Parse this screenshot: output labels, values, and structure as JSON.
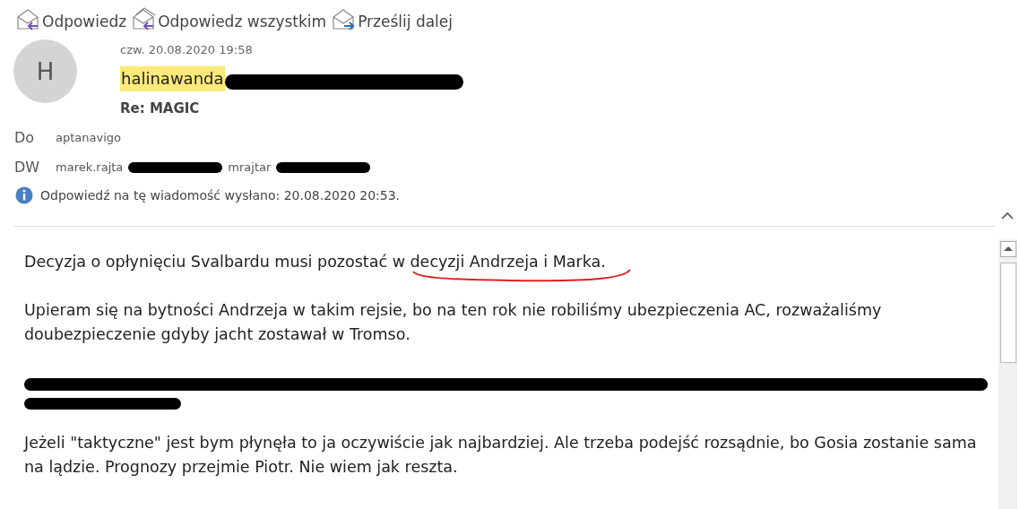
{
  "toolbar": [
    {
      "label": "Odpowiedz",
      "kind": "reply"
    },
    {
      "label": "Odpowiedz wszystkim",
      "kind": "reply-all"
    },
    {
      "label": "Prześlij dalej",
      "kind": "forward"
    }
  ],
  "message": {
    "avatar": "H",
    "date": "czw. 20.08.2020 19:58",
    "sender": {
      "name": "halinawanda",
      "highlighted": true,
      "redacted": true
    },
    "subject": "Re: MAGIC",
    "to": {
      "label": "Do",
      "recipients": [
        {
          "name": "aptanavigo"
        }
      ]
    },
    "cc": {
      "label": "DW",
      "recipients": [
        {
          "name": "marek.rajta",
          "redacted": true
        },
        {
          "name": "mrajtar",
          "redacted": true
        }
      ]
    },
    "info": "Odpowiedź na tę wiadomość wysłano: 20.08.2020 20:53."
  },
  "body": [
    {
      "kind": "text",
      "text": "Decyzja o opłynięciu Svalbardu musi pozostać w decyzji Andrzeja i Marka.",
      "annotated": true
    },
    {
      "kind": "text",
      "text": "Upieram się na bytności Andrzeja w takim rejsie, bo na ten rok nie robiliśmy ubezpieczenia AC, rozważaliśmy doubezpieczenie gdyby jacht zostawał w Tromso.",
      "annotated": false
    },
    {
      "kind": "redacted"
    },
    {
      "kind": "text",
      "text": "Jeżeli \"taktyczne\" jest bym płynęła to ja oczywiście jak najbardziej. Ale trzeba podejść rozsądnie, bo Gosia zostanie sama na lądzie. Prognozy przejmie Piotr. Nie wiem jak reszta.",
      "annotated": false
    }
  ]
}
